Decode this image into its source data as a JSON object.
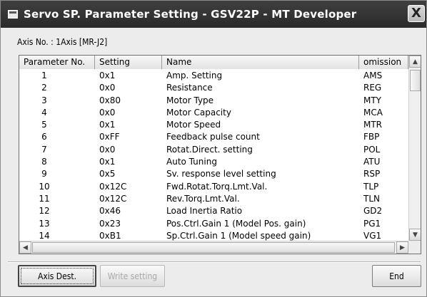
{
  "window": {
    "title": "Servo SP. Parameter Setting - GSV22P - MT Developer",
    "close_label": "X"
  },
  "axis_info": "Axis No. : 1Axis  [MR-J2]",
  "table": {
    "columns": [
      "Parameter No.",
      "Setting",
      "Name",
      "omission"
    ],
    "rows": [
      {
        "no": "1",
        "setting": "0x1",
        "name": "Amp. Setting",
        "omission": "AMS"
      },
      {
        "no": "2",
        "setting": "0x0",
        "name": "Resistance",
        "omission": "REG"
      },
      {
        "no": "3",
        "setting": "0x80",
        "name": "Motor Type",
        "omission": "MTY"
      },
      {
        "no": "4",
        "setting": "0x0",
        "name": "Motor Capacity",
        "omission": "MCA"
      },
      {
        "no": "5",
        "setting": "0x1",
        "name": "Motor Speed",
        "omission": "MTR"
      },
      {
        "no": "6",
        "setting": "0xFF",
        "name": "Feedback pulse count",
        "omission": "FBP"
      },
      {
        "no": "7",
        "setting": "0x0",
        "name": "Rotat.Direct. setting",
        "omission": "POL"
      },
      {
        "no": "8",
        "setting": "0x1",
        "name": "Auto Tuning",
        "omission": "ATU"
      },
      {
        "no": "9",
        "setting": "0x5",
        "name": "Sv. response level setting",
        "omission": "RSP"
      },
      {
        "no": "10",
        "setting": "0x12C",
        "name": "Fwd.Rotat.Torq.Lmt.Val.",
        "omission": "TLP"
      },
      {
        "no": "11",
        "setting": "0x12C",
        "name": "Rev.Torq.Lmt.Val.",
        "omission": "TLN"
      },
      {
        "no": "12",
        "setting": "0x46",
        "name": "Load Inertia Ratio",
        "omission": "GD2"
      },
      {
        "no": "13",
        "setting": "0x23",
        "name": "Pos.Ctrl.Gain 1 (Model Pos. gain)",
        "omission": "PG1"
      },
      {
        "no": "14",
        "setting": "0xB1",
        "name": "Sp.Ctrl.Gain 1 (Model speed gain)",
        "omission": "VG1"
      }
    ]
  },
  "buttons": {
    "axis_dest": "Axis Dest.",
    "write_setting": "Write setting",
    "end": "End"
  },
  "icons": {
    "window_icon": "window-icon",
    "scroll_up": "up-arrow-icon",
    "scroll_down": "down-arrow-icon",
    "scroll_left": "left-arrow-icon",
    "scroll_right": "right-arrow-icon"
  }
}
